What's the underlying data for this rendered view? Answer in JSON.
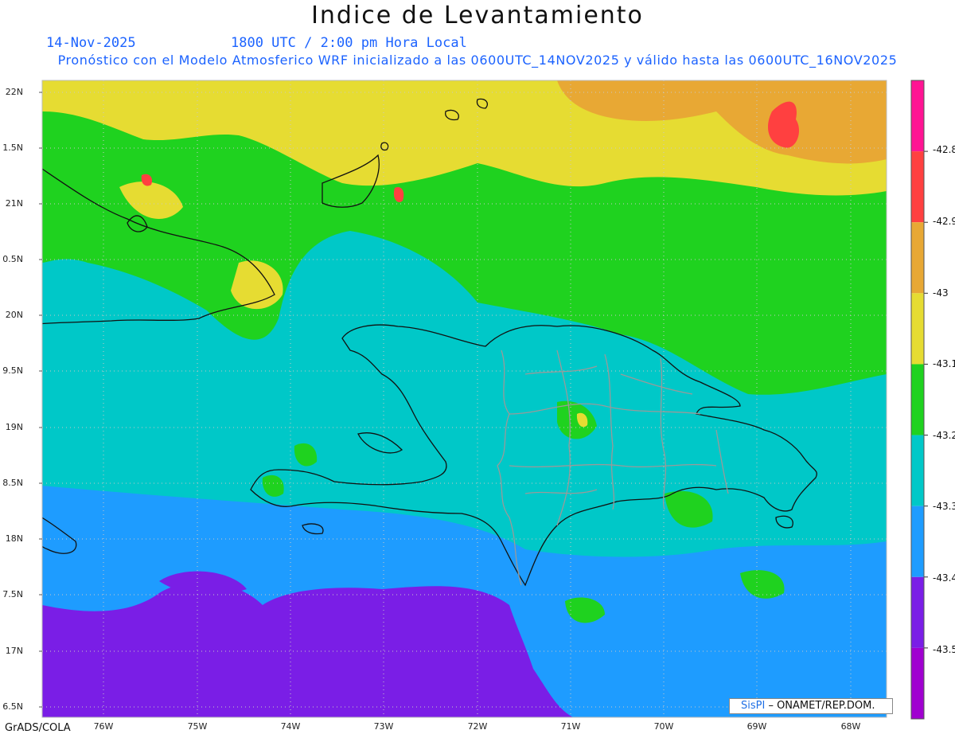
{
  "header": {
    "title": "Indice de Levantamiento",
    "date": "14-Nov-2025",
    "valid_time": "1800 UTC / 2:00 pm Hora Local",
    "forecast_note": "Pronóstico con el Modelo Atmosferico WRF inicializado a las 0600UTC_14NOV2025 y válido hasta las  0600UTC_16NOV2025"
  },
  "map": {
    "latitude_labels": [
      "22N",
      "1.5N",
      "21N",
      "0.5N",
      "20N",
      "9.5N",
      "19N",
      "8.5N",
      "18N",
      "7.5N",
      "17N",
      "6.5N"
    ],
    "longitude_labels": [
      "76W",
      "75W",
      "74W",
      "73W",
      "72W",
      "71W",
      "70W",
      "69W",
      "68W"
    ],
    "legend": {
      "labels": [
        "-42.8",
        "-42.9",
        "-43",
        "-43.1",
        "-43.2",
        "-43.3",
        "-43.4",
        "-43.5"
      ],
      "colors": [
        "#ff1493",
        "#ff4040",
        "#e8a834",
        "#e6dc32",
        "#1fd21f",
        "#00c8c8",
        "#1e9cff",
        "#7a1ee6",
        "#a000d0"
      ]
    },
    "credit": {
      "brand": "SisPI",
      "text": " – ONAMET/REP.DOM."
    }
  },
  "footer": {
    "software": "GrADS/COLA"
  }
}
